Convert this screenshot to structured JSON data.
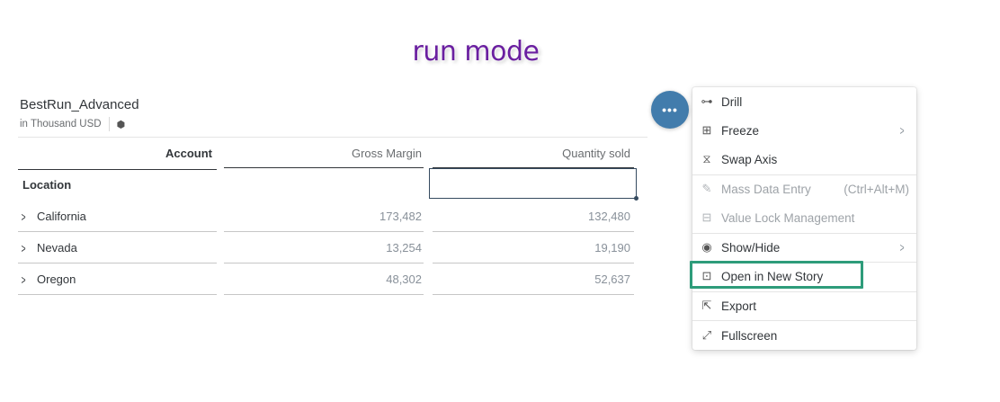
{
  "title": "run mode",
  "widget": {
    "name": "BestRun_Advanced",
    "unit": "in Thousand USD",
    "unit_icon": "cube-icon"
  },
  "table": {
    "columns": [
      "Account",
      "Gross Margin",
      "Quantity sold"
    ],
    "row_header": "Location",
    "rows": [
      {
        "name": "California",
        "gross_margin": "173,482",
        "quantity_sold": "132,480"
      },
      {
        "name": "Nevada",
        "gross_margin": "13,254",
        "quantity_sold": "19,190"
      },
      {
        "name": "Oregon",
        "gross_margin": "48,302",
        "quantity_sold": "52,637"
      }
    ]
  },
  "more_button": {
    "label": "•••",
    "color": "#427cac"
  },
  "menu": {
    "items": [
      {
        "label": "Drill",
        "icon": "drill-icon",
        "enabled": true,
        "submenu": false
      },
      {
        "label": "Freeze",
        "icon": "freeze-icon",
        "enabled": true,
        "submenu": true
      },
      {
        "label": "Swap Axis",
        "icon": "swap-axis-icon",
        "enabled": true,
        "submenu": false
      },
      {
        "label": "Mass Data Entry",
        "icon": "mass-data-entry-icon",
        "enabled": false,
        "shortcut": "(Ctrl+Alt+M)"
      },
      {
        "label": "Value Lock Management",
        "icon": "value-lock-icon",
        "enabled": false
      },
      {
        "label": "Show/Hide",
        "icon": "eye-icon",
        "enabled": true,
        "submenu": true
      },
      {
        "label": "Open in New Story",
        "icon": "story-icon",
        "enabled": true,
        "highlighted": true
      },
      {
        "label": "Export",
        "icon": "export-icon",
        "enabled": true
      },
      {
        "label": "Fullscreen",
        "icon": "fullscreen-icon",
        "enabled": true
      }
    ],
    "highlight_color": "#2e9c7a"
  }
}
